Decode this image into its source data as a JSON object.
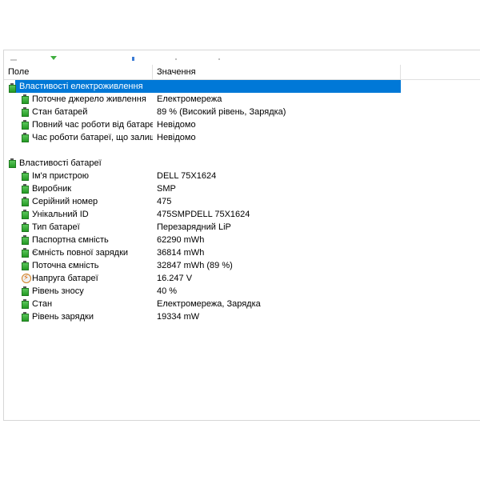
{
  "columns": {
    "field": "Поле",
    "value": "Значення"
  },
  "sections": [
    {
      "title": "Властивості електроживлення",
      "selected": true,
      "icon": "battery-icon",
      "rows": [
        {
          "field": "Поточне джерело живлення",
          "value": "Електромережа",
          "icon": "battery-icon"
        },
        {
          "field": "Стан батарей",
          "value": "89 % (Високий рівень, Зарядка)",
          "icon": "battery-icon"
        },
        {
          "field": "Повний час роботи від батареї",
          "value": "Невідомо",
          "icon": "battery-icon"
        },
        {
          "field": "Час роботи батареї, що залиш...",
          "value": "Невідомо",
          "icon": "battery-icon"
        }
      ]
    },
    {
      "title": "Властивості батареї",
      "selected": false,
      "icon": "battery-icon",
      "rows": [
        {
          "field": "Ім'я пристрою",
          "value": "DELL 75X1624",
          "icon": "battery-icon"
        },
        {
          "field": "Виробник",
          "value": "SMP",
          "icon": "battery-icon"
        },
        {
          "field": "Серійний номер",
          "value": "475",
          "icon": "battery-icon"
        },
        {
          "field": "Унікальний ID",
          "value": "475SMPDELL 75X1624",
          "icon": "battery-icon"
        },
        {
          "field": "Тип батареї",
          "value": "Перезарядний LiP",
          "icon": "battery-icon"
        },
        {
          "field": "Паспортна ємність",
          "value": "62290 mWh",
          "icon": "battery-icon"
        },
        {
          "field": "Ємність повної зарядки",
          "value": "36814 mWh",
          "icon": "battery-icon"
        },
        {
          "field": "Поточна ємність",
          "value": "32847 mWh  (89 %)",
          "icon": "battery-icon"
        },
        {
          "field": "Напруга батареї",
          "value": "16.247 V",
          "icon": "voltage-icon"
        },
        {
          "field": "Рівень зносу",
          "value": "40 %",
          "icon": "battery-icon"
        },
        {
          "field": "Стан",
          "value": "Електромережа, Зарядка",
          "icon": "battery-icon"
        },
        {
          "field": "Рівень зарядки",
          "value": "19334 mW",
          "icon": "battery-icon"
        }
      ]
    }
  ],
  "colors": {
    "selection": "#0078d7",
    "battery_green": "#2fa82f"
  }
}
